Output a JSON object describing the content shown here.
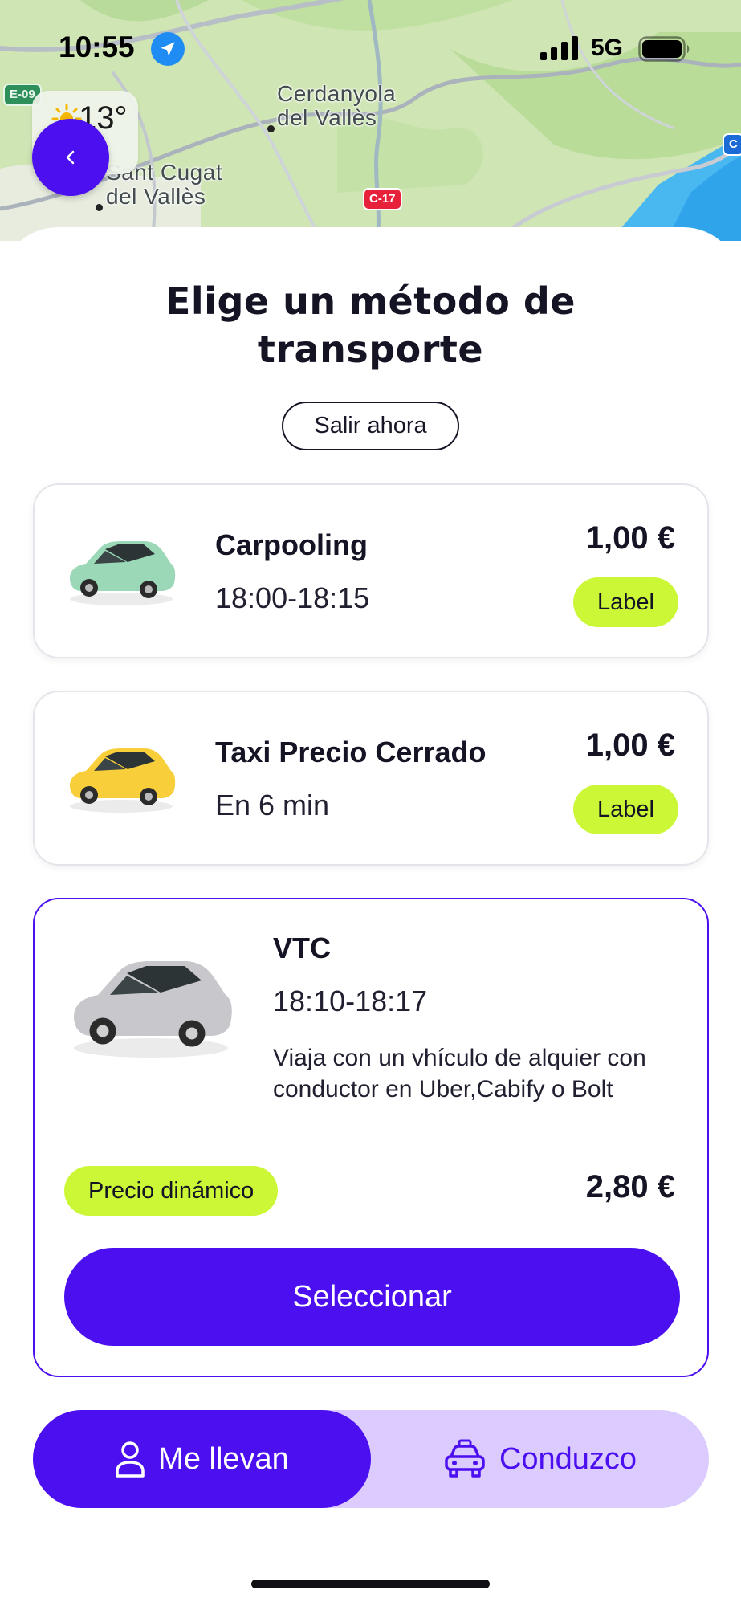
{
  "status_bar": {
    "time": "10:55",
    "network": "5G",
    "icons": [
      "location-arrow-icon",
      "signal-bars-icon",
      "battery-icon"
    ]
  },
  "map": {
    "places": [
      "Cerdanyola\ndel Vallès",
      "Sant Cugat\ndel Vallès"
    ],
    "road_badges": [
      "E-09",
      "C-17",
      "C"
    ],
    "weather_temp": "13°"
  },
  "sheet": {
    "title": "Elige un método de transporte",
    "depart_label": "Salir ahora"
  },
  "options": [
    {
      "name": "Carpooling",
      "time": "18:00-18:15",
      "price": "1,00 €",
      "label": "Label",
      "car_color": "#9ad8b8",
      "icon": "green-car-icon"
    },
    {
      "name": "Taxi Precio Cerrado",
      "time": "En 6 min",
      "price": "1,00 €",
      "label": "Label",
      "car_color": "#f8cf3a",
      "icon": "yellow-taxi-icon"
    },
    {
      "name": "VTC",
      "time": "18:10-18:17",
      "description": "Viaja con un vhículo de alquier con conductor en Uber,Cabify o Bolt",
      "badge": "Precio dinámico",
      "price": "2,80 €",
      "select_label": "Seleccionar",
      "car_color": "#c8c8cc",
      "icon": "silver-car-icon",
      "selected": true
    }
  ],
  "mode_toggle": {
    "passenger_label": "Me llevan",
    "driver_label": "Conduzco",
    "active": "passenger"
  },
  "colors": {
    "accent": "#4b0ff0",
    "badge": "#ccf736",
    "toggle_bg": "#dccbff"
  }
}
